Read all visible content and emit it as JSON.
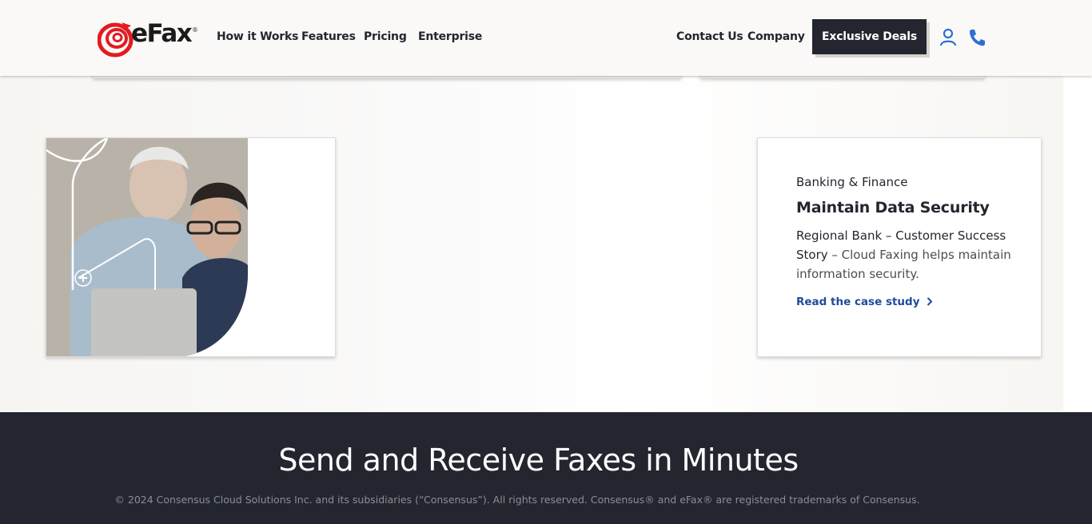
{
  "brand": {
    "logo_text": "eFax",
    "logo_mark": "®",
    "accent": "#e21b23"
  },
  "nav": {
    "left": [
      "How it Works",
      "Features",
      "Pricing",
      "Enterprise"
    ],
    "right": [
      "Contact Us",
      "Company"
    ],
    "cta": "Exclusive Deals",
    "icons": [
      "user-icon",
      "phone-icon"
    ],
    "icon_color": "#2a6fd6"
  },
  "case_study": {
    "category": "Banking & Finance",
    "title": "Maintain Data Security",
    "desc_strong": "Regional Bank – Customer Success Story",
    "desc_rest": " – Cloud Faxing helps maintain information security.",
    "link": "Read the case study"
  },
  "footer": {
    "title": "Send and Receive Faxes in Minutes",
    "copyright": "© 2024 Consensus Cloud Solutions Inc. and its subsidiaries (“Consensus”). All rights reserved. Consensus® and eFax® are registered trademarks of Consensus."
  }
}
